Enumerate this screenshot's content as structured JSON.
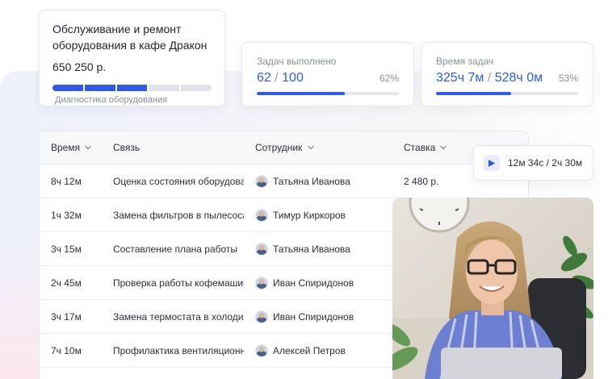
{
  "project": {
    "title": "Обслуживание и ремонт оборудования в кафе Дракон",
    "amount": "650 250 р.",
    "progress_segments_done": 3,
    "progress_segments_total": 5,
    "stage": "Диагностика оборудования"
  },
  "stats": [
    {
      "label": "Задач выполнено",
      "done": "62",
      "total": "100",
      "percent_label": "62%",
      "fraction": 0.62
    },
    {
      "label": "Время задач",
      "done": "325ч 7м",
      "total": "528ч 0м",
      "percent_label": "53%",
      "fraction": 0.53
    }
  ],
  "table": {
    "columns": [
      {
        "label": "Время",
        "sortable": true
      },
      {
        "label": "Связь",
        "sortable": false
      },
      {
        "label": "Сотрудник",
        "sortable": true
      },
      {
        "label": "Ставка",
        "sortable": true
      }
    ],
    "rows": [
      {
        "time": "8ч 12м",
        "task": "Оценка состояния оборудования",
        "employee": "Татьяна Иванова",
        "rate": "2 480 р."
      },
      {
        "time": "1ч 32м",
        "task": "Замена фильтров в пылесосах",
        "employee": "Тимур Киркоров",
        "rate": ""
      },
      {
        "time": "3ч 15м",
        "task": "Составление плана работы",
        "employee": "Татьяна Иванова",
        "rate": ""
      },
      {
        "time": "2ч 45м",
        "task": "Проверка работы кофемашины",
        "employee": "Иван Спиридонов",
        "rate": ""
      },
      {
        "time": "3ч 17м",
        "task": "Замена термостата в холодильнике",
        "employee": "Иван Спиридонов",
        "rate": ""
      },
      {
        "time": "7ч 10м",
        "task": "Профилактика вентиляционной системы",
        "employee": "Алексей Петров",
        "rate": ""
      }
    ]
  },
  "timer": {
    "text": "12м 34с / 2ч 30м",
    "icon": "play-icon"
  },
  "colors": {
    "accent": "#2f5be4",
    "muted": "#8a8f9c",
    "track": "#e3e6ed"
  }
}
